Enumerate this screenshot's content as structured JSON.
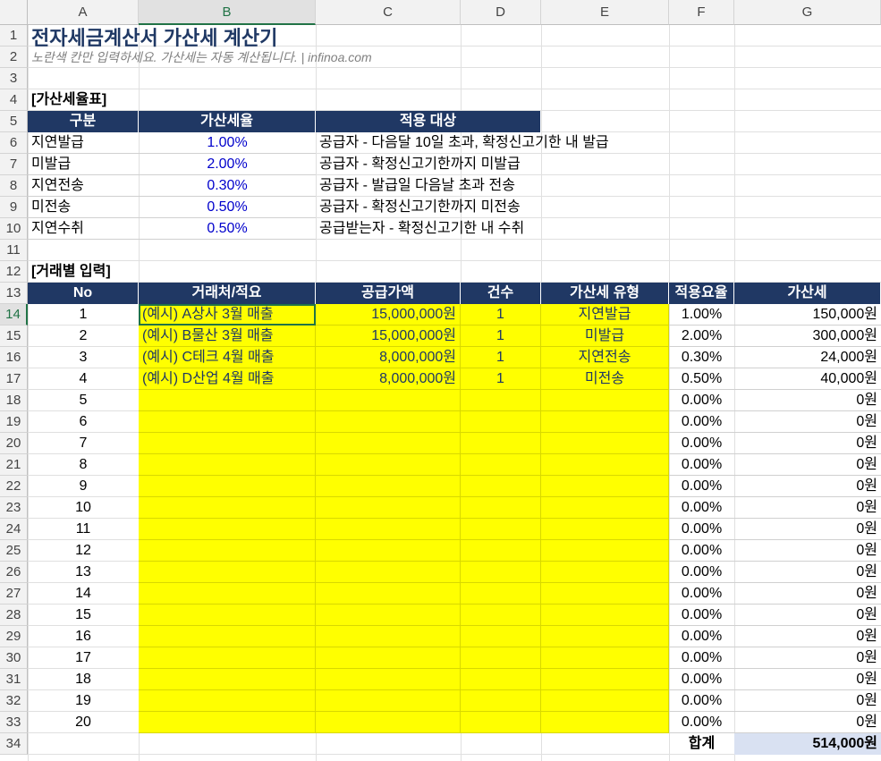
{
  "columns": [
    "A",
    "B",
    "C",
    "D",
    "E",
    "F",
    "G"
  ],
  "rows": [
    "1",
    "2",
    "3",
    "4",
    "5",
    "6",
    "7",
    "8",
    "9",
    "10",
    "11",
    "12",
    "13",
    "14",
    "15",
    "16",
    "17",
    "18",
    "19",
    "20",
    "21",
    "22",
    "23",
    "24",
    "25",
    "26",
    "27",
    "28",
    "29",
    "30",
    "31",
    "32",
    "33",
    "34"
  ],
  "title": "전자세금계산서 가산세 계산기",
  "subtitle": "노란색 칸만 입력하세요. 가산세는 자동 계산됩니다.  |  infinoa.com",
  "rate_table": {
    "section_label": "[가산세율표]",
    "headers": [
      "구분",
      "가산세율",
      "적용 대상"
    ],
    "rows": [
      {
        "type": "지연발급",
        "rate": "1.00%",
        "target": "공급자 - 다음달 10일 초과, 확정신고기한 내 발급"
      },
      {
        "type": "미발급",
        "rate": "2.00%",
        "target": "공급자 - 확정신고기한까지 미발급"
      },
      {
        "type": "지연전송",
        "rate": "0.30%",
        "target": "공급자 - 발급일 다음날 초과 전송"
      },
      {
        "type": "미전송",
        "rate": "0.50%",
        "target": "공급자 - 확정신고기한까지 미전송"
      },
      {
        "type": "지연수취",
        "rate": "0.50%",
        "target": "공급받는자 - 확정신고기한 내 수취"
      }
    ]
  },
  "input_table": {
    "section_label": "[거래별 입력]",
    "headers": [
      "No",
      "거래처/적요",
      "공급가액",
      "건수",
      "가산세 유형",
      "적용요율",
      "가산세"
    ],
    "rows": [
      {
        "no": "1",
        "desc": "(예시) A상사 3월 매출",
        "amount": "15,000,000원",
        "count": "1",
        "type": "지연발급",
        "rate": "1.00%",
        "tax": "150,000원"
      },
      {
        "no": "2",
        "desc": "(예시) B물산 3월 매출",
        "amount": "15,000,000원",
        "count": "1",
        "type": "미발급",
        "rate": "2.00%",
        "tax": "300,000원"
      },
      {
        "no": "3",
        "desc": "(예시) C테크 4월 매출",
        "amount": "8,000,000원",
        "count": "1",
        "type": "지연전송",
        "rate": "0.30%",
        "tax": "24,000원"
      },
      {
        "no": "4",
        "desc": "(예시) D산업 4월 매출",
        "amount": "8,000,000원",
        "count": "1",
        "type": "미전송",
        "rate": "0.50%",
        "tax": "40,000원"
      },
      {
        "no": "5",
        "desc": "",
        "amount": "",
        "count": "",
        "type": "",
        "rate": "0.00%",
        "tax": "0원"
      },
      {
        "no": "6",
        "desc": "",
        "amount": "",
        "count": "",
        "type": "",
        "rate": "0.00%",
        "tax": "0원"
      },
      {
        "no": "7",
        "desc": "",
        "amount": "",
        "count": "",
        "type": "",
        "rate": "0.00%",
        "tax": "0원"
      },
      {
        "no": "8",
        "desc": "",
        "amount": "",
        "count": "",
        "type": "",
        "rate": "0.00%",
        "tax": "0원"
      },
      {
        "no": "9",
        "desc": "",
        "amount": "",
        "count": "",
        "type": "",
        "rate": "0.00%",
        "tax": "0원"
      },
      {
        "no": "10",
        "desc": "",
        "amount": "",
        "count": "",
        "type": "",
        "rate": "0.00%",
        "tax": "0원"
      },
      {
        "no": "11",
        "desc": "",
        "amount": "",
        "count": "",
        "type": "",
        "rate": "0.00%",
        "tax": "0원"
      },
      {
        "no": "12",
        "desc": "",
        "amount": "",
        "count": "",
        "type": "",
        "rate": "0.00%",
        "tax": "0원"
      },
      {
        "no": "13",
        "desc": "",
        "amount": "",
        "count": "",
        "type": "",
        "rate": "0.00%",
        "tax": "0원"
      },
      {
        "no": "14",
        "desc": "",
        "amount": "",
        "count": "",
        "type": "",
        "rate": "0.00%",
        "tax": "0원"
      },
      {
        "no": "15",
        "desc": "",
        "amount": "",
        "count": "",
        "type": "",
        "rate": "0.00%",
        "tax": "0원"
      },
      {
        "no": "16",
        "desc": "",
        "amount": "",
        "count": "",
        "type": "",
        "rate": "0.00%",
        "tax": "0원"
      },
      {
        "no": "17",
        "desc": "",
        "amount": "",
        "count": "",
        "type": "",
        "rate": "0.00%",
        "tax": "0원"
      },
      {
        "no": "18",
        "desc": "",
        "amount": "",
        "count": "",
        "type": "",
        "rate": "0.00%",
        "tax": "0원"
      },
      {
        "no": "19",
        "desc": "",
        "amount": "",
        "count": "",
        "type": "",
        "rate": "0.00%",
        "tax": "0원"
      },
      {
        "no": "20",
        "desc": "",
        "amount": "",
        "count": "",
        "type": "",
        "rate": "0.00%",
        "tax": "0원"
      }
    ],
    "total_label": "합계",
    "total_value": "514,000원"
  },
  "colors": {
    "header_bg": "#203864",
    "input_yellow": "#ffff00",
    "total_bg": "#d9e1f2",
    "selection": "#217346"
  }
}
